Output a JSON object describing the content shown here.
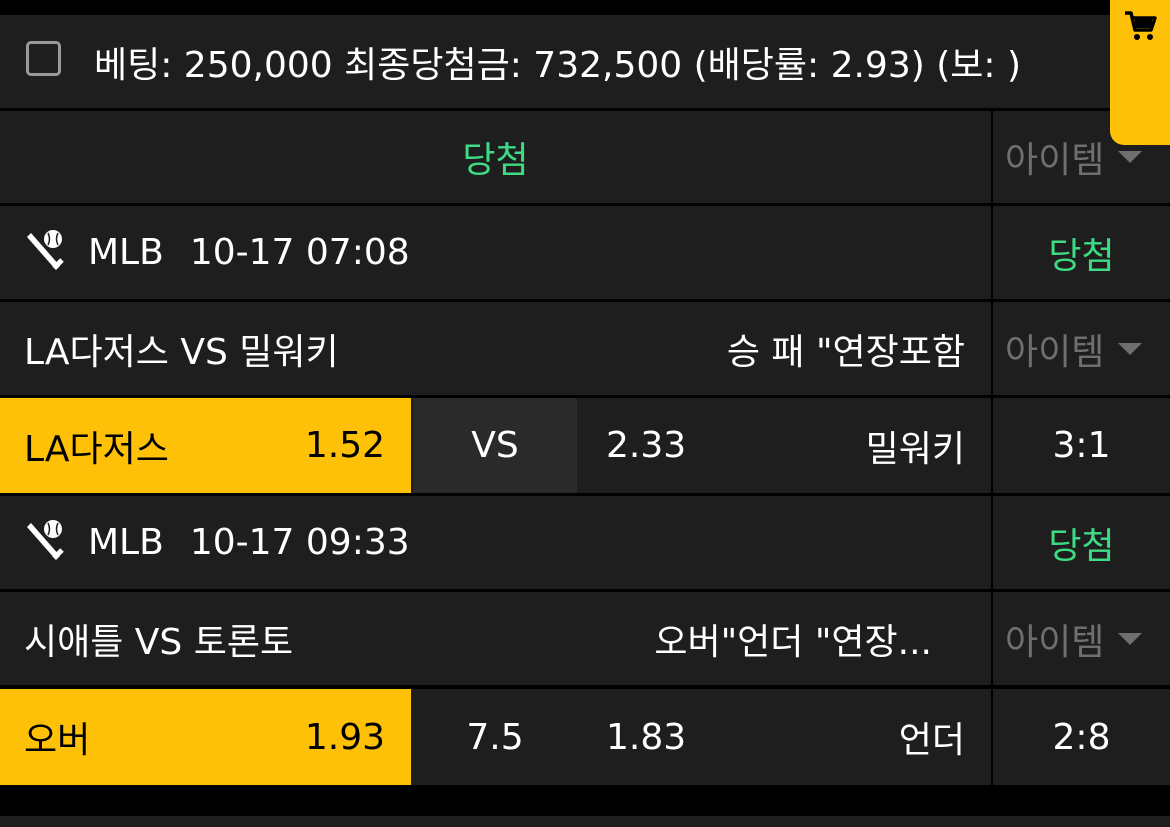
{
  "header": {
    "summary": "베팅: 250,000 최종당첨금: 732,500 (배당률: 2.93) (보: )"
  },
  "cart": {
    "icon": "cart-icon",
    "color": "#ffc107"
  },
  "overall": {
    "status": "당첨",
    "item_label": "아이템"
  },
  "matches": [
    {
      "sport_icon": "baseball-icon",
      "league": "MLB",
      "datetime": "10-17 07:08",
      "status": "당첨",
      "title": "LA다저스 VS 밀워키",
      "market": "승 패 \"연장포함",
      "item_label": "아이템",
      "home_name": "LA다저스",
      "home_odds": "1.52",
      "middle": "VS",
      "away_odds": "2.33",
      "away_name": "밀워키",
      "score": "3:1"
    },
    {
      "sport_icon": "baseball-icon",
      "league": "MLB",
      "datetime": "10-17 09:33",
      "status": "당첨",
      "title": "시애틀 VS 토론토",
      "market": "오버\"언더 \"연장...",
      "item_label": "아이템",
      "home_name": "오버",
      "home_odds": "1.93",
      "middle": "7.5",
      "away_odds": "1.83",
      "away_name": "언더",
      "score": "2:8"
    }
  ],
  "colors": {
    "accent": "#ffc107",
    "win": "#3ddc84",
    "row_bg": "#1e1e1e",
    "muted": "#6f6f6f"
  }
}
